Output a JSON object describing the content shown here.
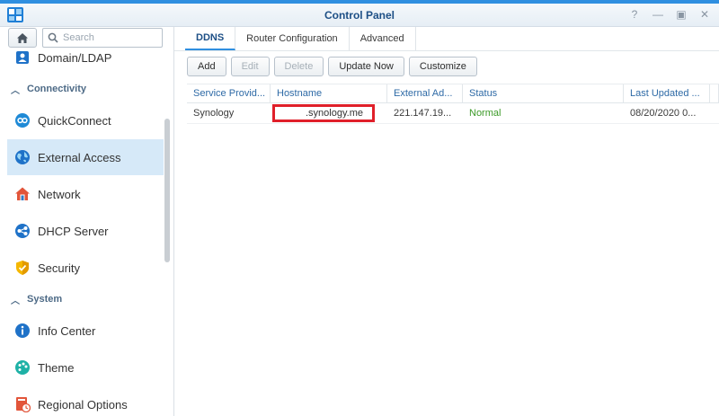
{
  "window": {
    "title": "Control Panel"
  },
  "search": {
    "placeholder": "Search"
  },
  "sidebar": {
    "partial_item": {
      "label": "Domain/LDAP"
    },
    "section_connectivity": "Connectivity",
    "items_connectivity": [
      {
        "label": "QuickConnect",
        "icon": "quickconnect-icon"
      },
      {
        "label": "External Access",
        "icon": "globe-icon",
        "active": true
      },
      {
        "label": "Network",
        "icon": "house-icon"
      },
      {
        "label": "DHCP Server",
        "icon": "dhcp-icon"
      },
      {
        "label": "Security",
        "icon": "shield-icon"
      }
    ],
    "section_system": "System",
    "items_system": [
      {
        "label": "Info Center",
        "icon": "info-icon"
      },
      {
        "label": "Theme",
        "icon": "palette-icon"
      },
      {
        "label": "Regional Options",
        "icon": "regional-icon"
      }
    ]
  },
  "tabs": [
    {
      "label": "DDNS",
      "active": true
    },
    {
      "label": "Router Configuration"
    },
    {
      "label": "Advanced"
    }
  ],
  "toolbar": {
    "add": "Add",
    "edit": "Edit",
    "delete": "Delete",
    "update_now": "Update Now",
    "customize": "Customize"
  },
  "table": {
    "columns": [
      "Service Provid...",
      "Hostname",
      "External Ad...",
      "Status",
      "Last Updated ..."
    ],
    "rows": [
      {
        "provider": "Synology",
        "hostname": ".synology.me",
        "external_address": "221.147.19...",
        "status": "Normal",
        "last_updated": "08/20/2020 0..."
      }
    ]
  },
  "colors": {
    "accent": "#2f8fe0",
    "status_normal": "#3c9a28",
    "highlight": "#e0202a"
  }
}
